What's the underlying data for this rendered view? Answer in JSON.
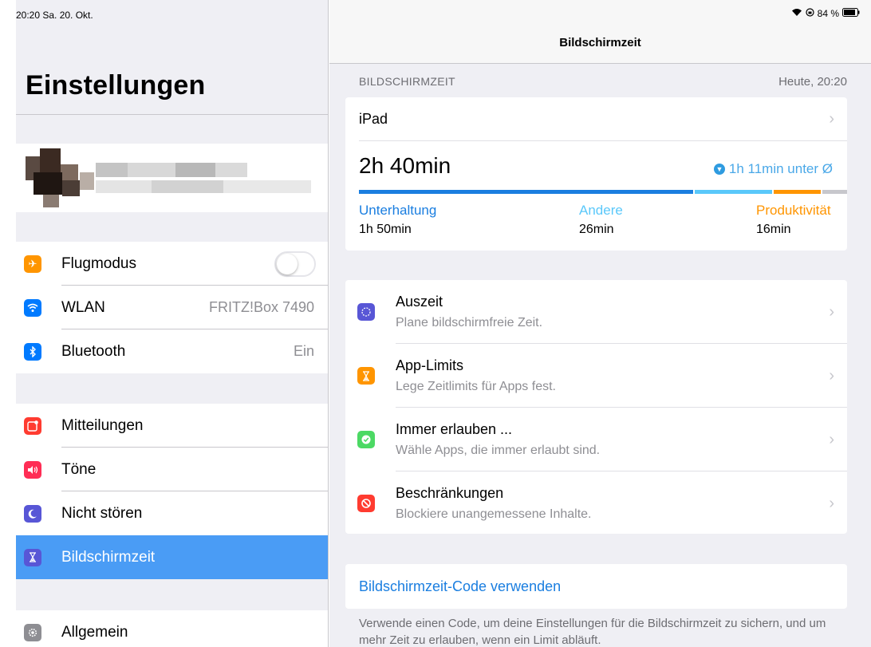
{
  "status_bar": {
    "time_date": "20:20  Sa. 20. Okt.",
    "battery": "84 %"
  },
  "sidebar": {
    "title": "Einstellungen",
    "groups": [
      {
        "items": [
          {
            "label": "Flugmodus",
            "icon": "airplane-icon",
            "color": "#ff9500",
            "accessory": "toggle-off"
          },
          {
            "label": "WLAN",
            "icon": "wifi-icon",
            "color": "#007aff",
            "value": "FRITZ!Box 7490"
          },
          {
            "label": "Bluetooth",
            "icon": "bluetooth-icon",
            "color": "#007aff",
            "value": "Ein"
          }
        ]
      },
      {
        "items": [
          {
            "label": "Mitteilungen",
            "icon": "notifications-icon",
            "color": "#ff3b30"
          },
          {
            "label": "Töne",
            "icon": "speaker-icon",
            "color": "#ff2d55"
          },
          {
            "label": "Nicht stören",
            "icon": "moon-icon",
            "color": "#5856d6"
          },
          {
            "label": "Bildschirmzeit",
            "icon": "hourglass-icon",
            "color": "#5856d6",
            "selected": true
          }
        ]
      },
      {
        "items": [
          {
            "label": "Allgemein",
            "icon": "gear-icon",
            "color": "#8e8e93"
          }
        ]
      }
    ]
  },
  "main": {
    "nav_title": "Bildschirmzeit",
    "section_header": "BILDSCHIRMZEIT",
    "section_date": "Heute, 20:20",
    "device": "iPad",
    "total_time": "2h 40min",
    "avg_diff": "1h 11min unter Ø",
    "categories": [
      {
        "name": "Unterhaltung",
        "time": "1h 50min",
        "color": "#1a7ee0",
        "share": 0.6875
      },
      {
        "name": "Andere",
        "time": "26min",
        "color": "#5ac8fa",
        "share": 0.1625
      },
      {
        "name": "Produktivität",
        "time": "16min",
        "color": "#ff9500",
        "share": 0.1
      }
    ],
    "remainder_color": "#c7c7cc",
    "features": [
      {
        "title": "Auszeit",
        "subtitle": "Plane bildschirmfreie Zeit.",
        "icon": "downtime-icon",
        "color": "#5856d6"
      },
      {
        "title": "App-Limits",
        "subtitle": "Lege Zeitlimits für Apps fest.",
        "icon": "hourglass-icon",
        "color": "#ff9500"
      },
      {
        "title": "Immer erlauben ...",
        "subtitle": "Wähle Apps, die immer erlaubt sind.",
        "icon": "checkmark-icon",
        "color": "#4cd964"
      },
      {
        "title": "Beschränkungen",
        "subtitle": "Blockiere unangemessene Inhalte.",
        "icon": "restrict-icon",
        "color": "#ff3b30"
      }
    ],
    "code_link": "Bildschirmzeit-Code verwenden",
    "code_footer": "Verwende einen Code, um deine Einstellungen für die Bildschirmzeit zu sichern, und um mehr Zeit zu erlauben, wenn ein Limit abläuft."
  }
}
